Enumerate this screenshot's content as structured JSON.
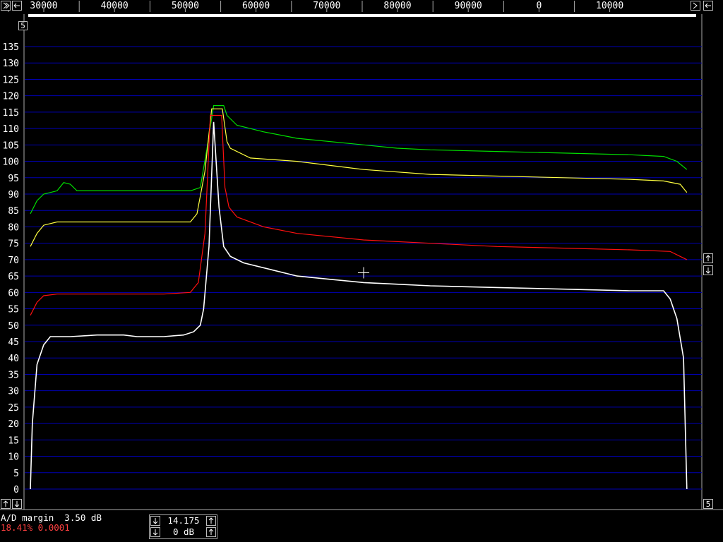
{
  "chart_data": {
    "type": "line",
    "top_axis": {
      "tick_labels": [
        "30000",
        "40000",
        "50000",
        "60000",
        "70000",
        "80000",
        "90000",
        "0",
        "10000"
      ]
    },
    "yticks": [
      0,
      5,
      10,
      15,
      20,
      25,
      30,
      35,
      40,
      45,
      50,
      55,
      60,
      65,
      70,
      75,
      80,
      85,
      90,
      95,
      100,
      105,
      110,
      115,
      120,
      125,
      130,
      135
    ],
    "ylim": [
      -1.5,
      138
    ],
    "xlim": [
      0,
      1
    ],
    "grid": true,
    "series": [
      {
        "color": "#00e000",
        "points": [
          [
            0,
            84
          ],
          [
            0.01,
            88
          ],
          [
            0.02,
            90
          ],
          [
            0.04,
            91
          ],
          [
            0.05,
            93.5
          ],
          [
            0.06,
            93
          ],
          [
            0.07,
            91
          ],
          [
            0.09,
            91
          ],
          [
            0.12,
            91
          ],
          [
            0.16,
            91
          ],
          [
            0.2,
            91
          ],
          [
            0.24,
            91
          ],
          [
            0.255,
            92
          ],
          [
            0.265,
            104
          ],
          [
            0.275,
            117
          ],
          [
            0.29,
            117
          ],
          [
            0.295,
            114
          ],
          [
            0.31,
            111
          ],
          [
            0.35,
            109
          ],
          [
            0.4,
            107
          ],
          [
            0.5,
            105
          ],
          [
            0.55,
            104
          ],
          [
            0.6,
            103.5
          ],
          [
            0.7,
            103
          ],
          [
            0.8,
            102.5
          ],
          [
            0.9,
            102
          ],
          [
            0.95,
            101.5
          ],
          [
            0.97,
            100
          ],
          [
            0.985,
            97.5
          ]
        ]
      },
      {
        "color": "#ffff40",
        "points": [
          [
            0,
            74
          ],
          [
            0.01,
            78
          ],
          [
            0.02,
            80.5
          ],
          [
            0.04,
            81.5
          ],
          [
            0.08,
            81.5
          ],
          [
            0.12,
            81.5
          ],
          [
            0.16,
            81.5
          ],
          [
            0.2,
            81.5
          ],
          [
            0.24,
            81.5
          ],
          [
            0.25,
            84
          ],
          [
            0.262,
            97
          ],
          [
            0.272,
            116
          ],
          [
            0.288,
            116
          ],
          [
            0.295,
            106
          ],
          [
            0.3,
            104
          ],
          [
            0.33,
            101
          ],
          [
            0.4,
            100
          ],
          [
            0.5,
            97.5
          ],
          [
            0.6,
            96
          ],
          [
            0.7,
            95.5
          ],
          [
            0.8,
            95
          ],
          [
            0.9,
            94.5
          ],
          [
            0.95,
            94
          ],
          [
            0.975,
            93
          ],
          [
            0.985,
            90.5
          ]
        ]
      },
      {
        "color": "#ff1010",
        "points": [
          [
            0,
            53
          ],
          [
            0.01,
            57
          ],
          [
            0.02,
            59
          ],
          [
            0.04,
            59.5
          ],
          [
            0.08,
            59.5
          ],
          [
            0.12,
            59.5
          ],
          [
            0.16,
            59.5
          ],
          [
            0.2,
            59.5
          ],
          [
            0.24,
            60
          ],
          [
            0.252,
            63
          ],
          [
            0.262,
            78
          ],
          [
            0.27,
            114
          ],
          [
            0.287,
            114
          ],
          [
            0.292,
            92
          ],
          [
            0.298,
            86
          ],
          [
            0.31,
            83
          ],
          [
            0.35,
            80
          ],
          [
            0.4,
            78
          ],
          [
            0.5,
            76
          ],
          [
            0.6,
            75
          ],
          [
            0.7,
            74
          ],
          [
            0.8,
            73.5
          ],
          [
            0.9,
            73
          ],
          [
            0.96,
            72.5
          ],
          [
            0.985,
            70
          ]
        ]
      },
      {
        "color": "#ffffff",
        "points": [
          [
            0,
            0
          ],
          [
            0.003,
            20
          ],
          [
            0.01,
            38
          ],
          [
            0.02,
            44
          ],
          [
            0.03,
            46.5
          ],
          [
            0.06,
            46.5
          ],
          [
            0.1,
            47
          ],
          [
            0.14,
            47
          ],
          [
            0.16,
            46.5
          ],
          [
            0.2,
            46.5
          ],
          [
            0.23,
            47
          ],
          [
            0.245,
            48
          ],
          [
            0.255,
            50
          ],
          [
            0.26,
            55
          ],
          [
            0.268,
            74
          ],
          [
            0.275,
            112
          ],
          [
            0.283,
            86
          ],
          [
            0.29,
            74
          ],
          [
            0.3,
            71
          ],
          [
            0.32,
            69
          ],
          [
            0.36,
            67
          ],
          [
            0.4,
            65
          ],
          [
            0.45,
            64
          ],
          [
            0.5,
            63
          ],
          [
            0.55,
            62.5
          ],
          [
            0.6,
            62
          ],
          [
            0.7,
            61.5
          ],
          [
            0.8,
            61
          ],
          [
            0.9,
            60.5
          ],
          [
            0.95,
            60.5
          ],
          [
            0.96,
            58
          ],
          [
            0.97,
            52
          ],
          [
            0.98,
            40
          ],
          [
            0.985,
            0
          ]
        ]
      }
    ]
  },
  "cursor": {
    "x": 0.5,
    "y": 66
  },
  "status": {
    "line1": "A/D margin  3.50 dB",
    "line2": "18.41% 0.0001",
    "ctrl_value1": "14.175",
    "ctrl_value2": "0 dB",
    "top_left_box": "5",
    "bottom_right_box": "5"
  },
  "colors": {
    "grid": "#0000b4",
    "background": "#000000",
    "status_red": "#ff4040"
  }
}
